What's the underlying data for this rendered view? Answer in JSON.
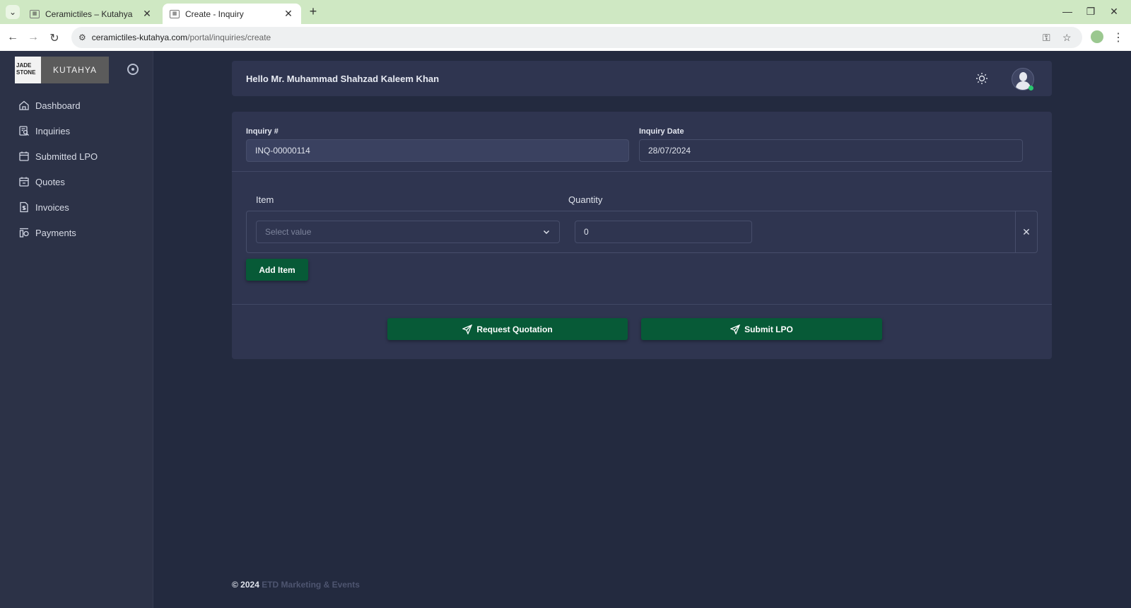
{
  "browser": {
    "tabs": [
      {
        "title": "Ceramictiles – Kutahya",
        "active": false
      },
      {
        "title": "Create - Inquiry",
        "active": true
      }
    ],
    "url_host": "ceramictiles-kutahya.com",
    "url_path": "/portal/inquiries/create",
    "new_tab": "+",
    "close": "✕",
    "minimize": "—",
    "restore": "❐"
  },
  "sidebar": {
    "logo": {
      "left_text": "JADE STONE",
      "right_text": "KUTAHYA"
    },
    "items": [
      {
        "label": "Dashboard",
        "icon": "home-icon"
      },
      {
        "label": "Inquiries",
        "icon": "inquiry-icon"
      },
      {
        "label": "Submitted LPO",
        "icon": "calendar-icon"
      },
      {
        "label": "Quotes",
        "icon": "calendar-icon"
      },
      {
        "label": "Invoices",
        "icon": "invoice-icon"
      },
      {
        "label": "Payments",
        "icon": "payments-icon"
      }
    ]
  },
  "header": {
    "greeting": "Hello Mr. Muhammad Shahzad Kaleem Khan"
  },
  "form": {
    "inquiry_no_label": "Inquiry #",
    "inquiry_no_value": "INQ-00000114",
    "inquiry_date_label": "Inquiry Date",
    "inquiry_date_value": "28/07/2024",
    "item_label": "Item",
    "quantity_label": "Quantity",
    "item_placeholder": "Select value",
    "quantity_value": "0",
    "remove_label": "✕",
    "add_item": "Add Item",
    "request_quotation": "Request Quotation",
    "submit_lpo": "Submit LPO"
  },
  "footer": {
    "copyright": "© 2024",
    "company": "ETD Marketing & Events"
  },
  "colors": {
    "page_bg": "#232a3f",
    "sidebar_bg": "#2c3247",
    "card_bg": "#2f3550",
    "accent_green": "#075a37",
    "browser_tabbar": "#cfe8c3"
  }
}
